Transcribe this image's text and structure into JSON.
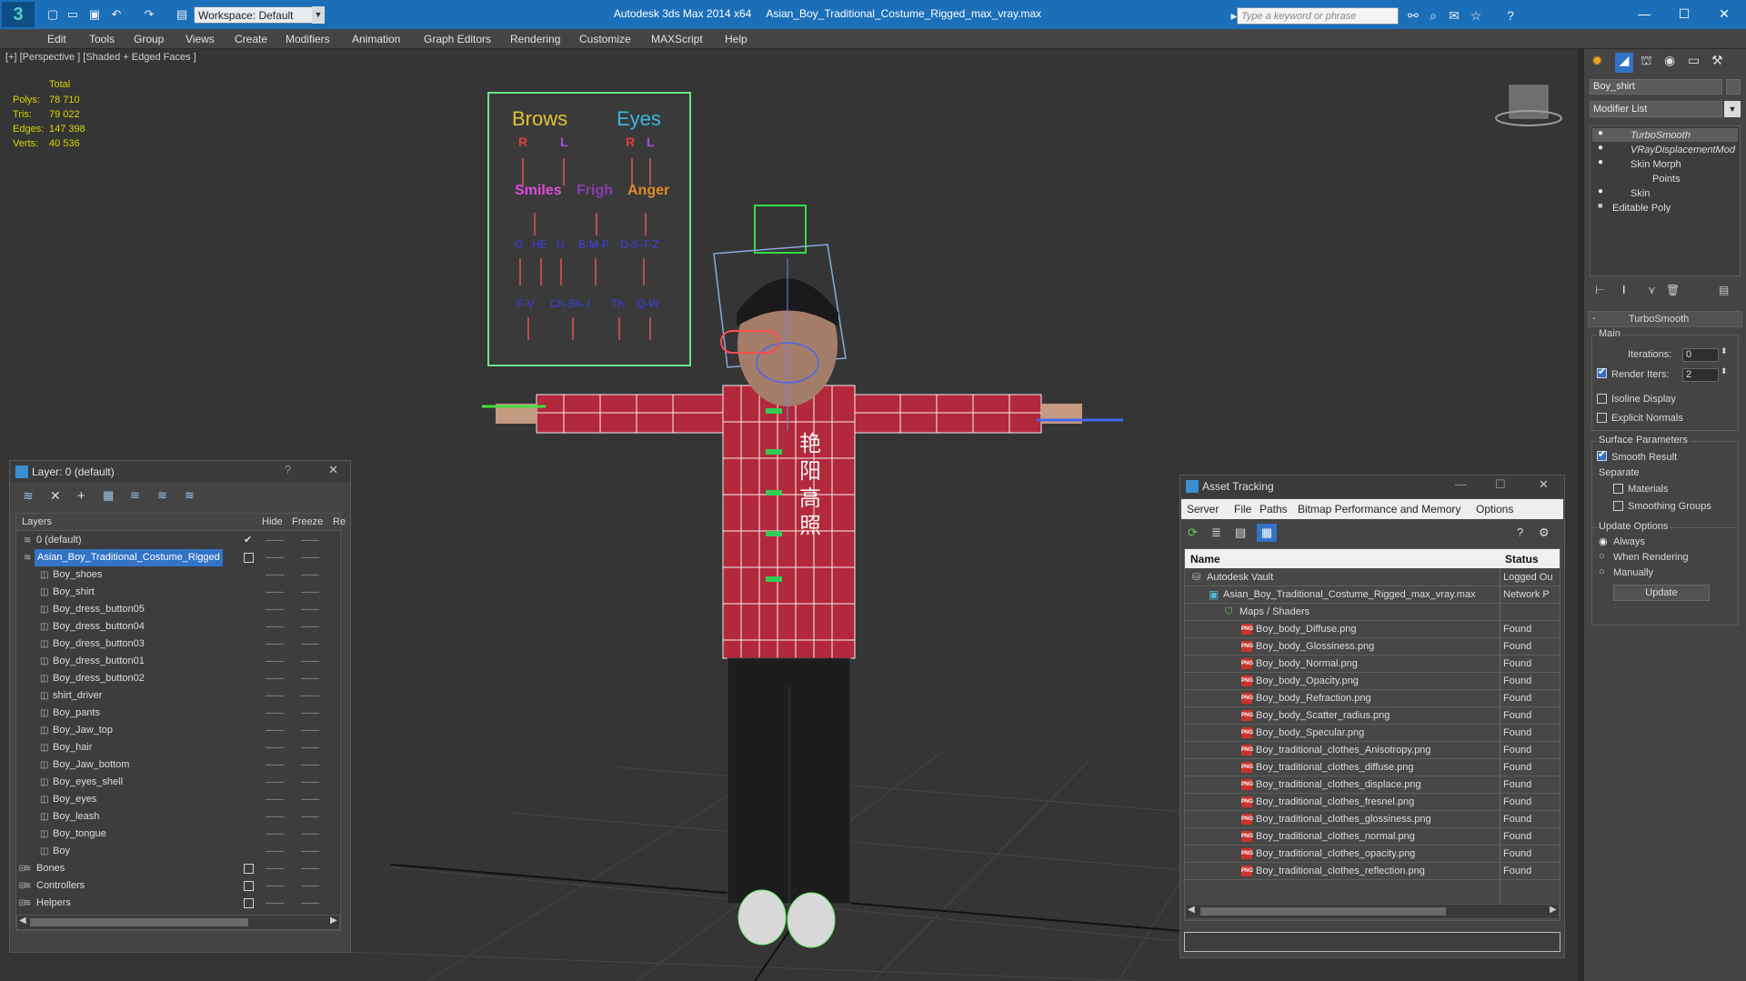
{
  "titlebar": {
    "workspace_label": "Workspace: Default",
    "app_title": "Autodesk 3ds Max  2014 x64",
    "file_title": "Asian_Boy_Traditional_Costume_Rigged_max_vray.max",
    "search_placeholder": "Type a keyword or phrase"
  },
  "menu": [
    "Edit",
    "Tools",
    "Group",
    "Views",
    "Create",
    "Modifiers",
    "Animation",
    "Graph Editors",
    "Rendering",
    "Customize",
    "MAXScript",
    "Help"
  ],
  "viewport": {
    "label": "[+] [Perspective ] [Shaded + Edged Faces ]",
    "stats_header": "Total",
    "stats": [
      {
        "label": "Polys:",
        "value": "78 710"
      },
      {
        "label": "Tris:",
        "value": "79 022"
      },
      {
        "label": "Edges:",
        "value": "147 398"
      },
      {
        "label": "Verts:",
        "value": "40 536"
      }
    ],
    "face_rig": {
      "brows": "Brows",
      "eyes": "Eyes",
      "r1": "R",
      "l1": "L",
      "r2": "R",
      "l2": "L",
      "smiles": "Smiles",
      "frigh": "Frigh",
      "anger": "Anger",
      "row3": [
        "O",
        "HE",
        "U",
        "B-M-P",
        "D-S-T-Z"
      ],
      "row4": [
        "F-V",
        "Ch-Sh-J",
        "Th",
        "Q-W"
      ]
    },
    "shirt_text": [
      "艳",
      "阳",
      "高",
      "照"
    ]
  },
  "layer_window": {
    "title": "Layer: 0 (default)",
    "columns": [
      "Layers",
      "Hide",
      "Freeze",
      "Re"
    ],
    "rows": [
      {
        "name": "0 (default)",
        "level": 0,
        "kind": "layer",
        "active": true
      },
      {
        "name": "Asian_Boy_Traditional_Costume_Rigged",
        "level": 0,
        "kind": "layer",
        "selected": true
      },
      {
        "name": "Boy_shoes",
        "level": 1,
        "kind": "object"
      },
      {
        "name": "Boy_shirt",
        "level": 1,
        "kind": "object"
      },
      {
        "name": "Boy_dress_button05",
        "level": 1,
        "kind": "object"
      },
      {
        "name": "Boy_dress_button04",
        "level": 1,
        "kind": "object"
      },
      {
        "name": "Boy_dress_button03",
        "level": 1,
        "kind": "object"
      },
      {
        "name": "Boy_dress_button01",
        "level": 1,
        "kind": "object"
      },
      {
        "name": "Boy_dress_button02",
        "level": 1,
        "kind": "object"
      },
      {
        "name": "shirt_driver",
        "level": 1,
        "kind": "object"
      },
      {
        "name": "Boy_pants",
        "level": 1,
        "kind": "object"
      },
      {
        "name": "Boy_Jaw_top",
        "level": 1,
        "kind": "object"
      },
      {
        "name": "Boy_hair",
        "level": 1,
        "kind": "object"
      },
      {
        "name": "Boy_Jaw_bottom",
        "level": 1,
        "kind": "object"
      },
      {
        "name": "Boy_eyes_shell",
        "level": 1,
        "kind": "object"
      },
      {
        "name": "Boy_eyes",
        "level": 1,
        "kind": "object"
      },
      {
        "name": "Boy_leash",
        "level": 1,
        "kind": "object"
      },
      {
        "name": "Boy_tongue",
        "level": 1,
        "kind": "object"
      },
      {
        "name": "Boy",
        "level": 1,
        "kind": "object"
      },
      {
        "name": "Bones",
        "level": 0,
        "kind": "layer-collapsed"
      },
      {
        "name": "Controllers",
        "level": 0,
        "kind": "layer-collapsed"
      },
      {
        "name": "Helpers",
        "level": 0,
        "kind": "layer-collapsed"
      }
    ]
  },
  "asset_window": {
    "title": "Asset Tracking",
    "menu": [
      "Server",
      "File",
      "Paths",
      "Bitmap Performance and Memory",
      "Options"
    ],
    "columns": [
      "Name",
      "Status"
    ],
    "rows": [
      {
        "name": "Autodesk Vault",
        "status": "Logged Ou",
        "level": 0,
        "kind": "vault"
      },
      {
        "name": "Asian_Boy_Traditional_Costume_Rigged_max_vray.max",
        "status": "Network P",
        "level": 1,
        "kind": "max"
      },
      {
        "name": "Maps / Shaders",
        "status": "",
        "level": 2,
        "kind": "folder"
      },
      {
        "name": "Boy_body_Diffuse.png",
        "status": "Found",
        "level": 3,
        "kind": "png"
      },
      {
        "name": "Boy_body_Glossiness.png",
        "status": "Found",
        "level": 3,
        "kind": "png"
      },
      {
        "name": "Boy_body_Normal.png",
        "status": "Found",
        "level": 3,
        "kind": "png"
      },
      {
        "name": "Boy_body_Opacity.png",
        "status": "Found",
        "level": 3,
        "kind": "png"
      },
      {
        "name": "Boy_body_Refraction.png",
        "status": "Found",
        "level": 3,
        "kind": "png"
      },
      {
        "name": "Boy_body_Scatter_radius.png",
        "status": "Found",
        "level": 3,
        "kind": "png"
      },
      {
        "name": "Boy_body_Specular.png",
        "status": "Found",
        "level": 3,
        "kind": "png"
      },
      {
        "name": "Boy_traditional_clothes_Anisotropy.png",
        "status": "Found",
        "level": 3,
        "kind": "png"
      },
      {
        "name": "Boy_traditional_clothes_diffuse.png",
        "status": "Found",
        "level": 3,
        "kind": "png"
      },
      {
        "name": "Boy_traditional_clothes_displace.png",
        "status": "Found",
        "level": 3,
        "kind": "png"
      },
      {
        "name": "Boy_traditional_clothes_fresnel.png",
        "status": "Found",
        "level": 3,
        "kind": "png"
      },
      {
        "name": "Boy_traditional_clothes_glossiness.png",
        "status": "Found",
        "level": 3,
        "kind": "png"
      },
      {
        "name": "Boy_traditional_clothes_normal.png",
        "status": "Found",
        "level": 3,
        "kind": "png"
      },
      {
        "name": "Boy_traditional_clothes_opacity.png",
        "status": "Found",
        "level": 3,
        "kind": "png"
      },
      {
        "name": "Boy_traditional_clothes_reflection.png",
        "status": "Found",
        "level": 3,
        "kind": "png"
      }
    ]
  },
  "command_panel": {
    "object_name": "Boy_shirt",
    "modifier_list": "Modifier List",
    "stack": [
      {
        "name": "TurboSmooth",
        "italic": true
      },
      {
        "name": "VRayDisplacementMod",
        "italic": true
      },
      {
        "name": "Skin Morph",
        "italic": false
      },
      {
        "name": "Points",
        "italic": false,
        "sub": true
      },
      {
        "name": "Skin",
        "italic": false
      },
      {
        "name": "Editable Poly",
        "italic": false
      }
    ],
    "rollout_title": "TurboSmooth",
    "main_group": "Main",
    "iterations_label": "Iterations:",
    "iterations_value": "0",
    "render_iters_label": "Render Iters:",
    "render_iters_value": "2",
    "isoline": "Isoline Display",
    "explicit_normals": "Explicit Normals",
    "surface_params": "Surface Parameters",
    "smooth_result": "Smooth Result",
    "separate": "Separate",
    "materials": "Materials",
    "smoothing_groups": "Smoothing Groups",
    "update_options": "Update Options",
    "always": "Always",
    "when_rendering": "When Rendering",
    "manually": "Manually",
    "update_button": "Update"
  },
  "colors": {
    "titlebar": "#1b6fb8",
    "panel": "#444444",
    "viewport": "#353535",
    "selection": "#3273c6",
    "stats": "#d6d600"
  }
}
